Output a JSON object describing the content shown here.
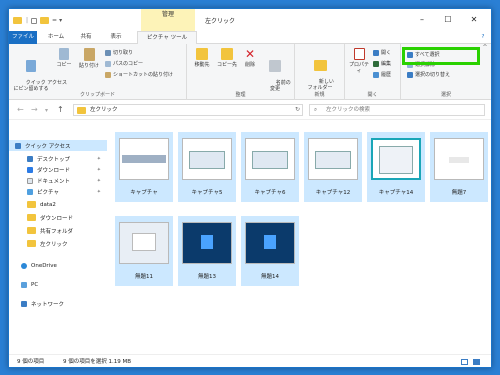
{
  "titlebar": {
    "context_tab": "管理",
    "title": "左クリック"
  },
  "tabs": {
    "file": "ファイル",
    "home": "ホーム",
    "share": "共有",
    "view": "表示",
    "picture_tools": "ピクチャ ツール"
  },
  "ribbon": {
    "pin_quick": "クイック アクセス\nにピン留めする",
    "copy": "コピー",
    "paste": "貼り付け",
    "cut": "切り取り",
    "copy_path": "パスのコピー",
    "paste_shortcut": "ショートカットの貼り付け",
    "clipboard_group": "クリップボード",
    "move_to": "移動先",
    "copy_to": "コピー先",
    "delete": "削除",
    "rename": "名前の\n変更",
    "organize_group": "整理",
    "new_folder": "新しい\nフォルダー",
    "new_group": "新規",
    "properties": "プロパティ",
    "open": "開く",
    "edit": "編集",
    "history": "履歴",
    "open_group": "開く",
    "select_all": "すべて選択",
    "select_none": "選択解除",
    "invert_selection": "選択の切り替え",
    "select_group": "選択"
  },
  "address": {
    "path": "左クリック",
    "search_placeholder": "左クリックの検索"
  },
  "nav": {
    "quick_access": "クイック アクセス",
    "desktop": "デスクトップ",
    "downloads": "ダウンロード",
    "documents": "ドキュメント",
    "pictures": "ピクチャ",
    "f1": "data2",
    "f2": "ダウンロード",
    "f3": "共有フォルダ",
    "f4": "左クリック",
    "onedrive": "OneDrive",
    "pc": "PC",
    "network": "ネットワーク"
  },
  "files": [
    "キャプチャ",
    "キャプチャ5",
    "キャプチャ6",
    "キャプチャ12",
    "キャプチャ14",
    "無題7",
    "無題11",
    "無題13",
    "無題14"
  ],
  "status": {
    "count": "9 個の項目",
    "selected": "9 個の項目を選択 1.19 MB"
  },
  "colors": {
    "accent": "#1a6fc4",
    "selection": "#cce8ff",
    "highlight": "#2ad100",
    "folder": "#f2c43d",
    "desktop": "#2a7fd4"
  }
}
